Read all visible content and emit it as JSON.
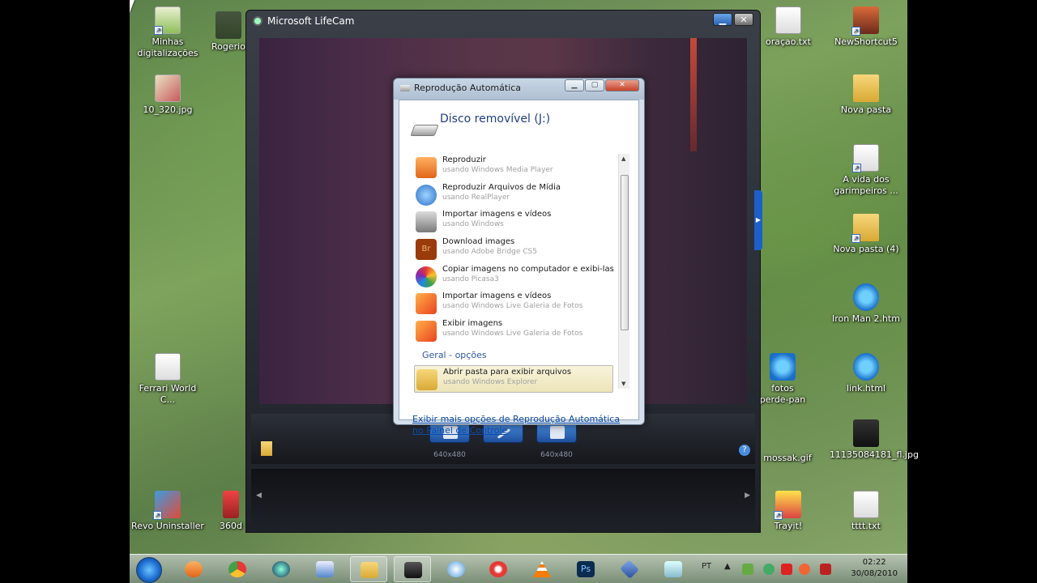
{
  "desktop": {
    "icons_left": [
      {
        "label": "Minhas digitalizações",
        "icon": "scanner-folder-icon"
      },
      {
        "label": "Rogerio",
        "icon": "folder-icon"
      },
      {
        "label": "10_320.jpg",
        "icon": "image-file-icon"
      },
      {
        "label": "Ferrari World C...",
        "icon": "file-icon"
      },
      {
        "label": "Revo Uninstaller",
        "icon": "uninstaller-icon"
      },
      {
        "label": "360d",
        "icon": "app-icon"
      }
    ],
    "icons_right": [
      {
        "label": "oraçao.txt",
        "icon": "text-file-icon"
      },
      {
        "label": "NewShortcut5",
        "icon": "game-icon"
      },
      {
        "label": "Nova pasta",
        "icon": "folder-icon"
      },
      {
        "label": "A vida dos garimpeiros ...",
        "icon": "file-icon"
      },
      {
        "label": "Nova pasta (4)",
        "icon": "folder-icon"
      },
      {
        "label": "Iron Man 2.htm",
        "icon": "ie-icon"
      },
      {
        "label": "fotos perde-pan",
        "icon": "image-file-icon"
      },
      {
        "label": "link.html",
        "icon": "ie-icon"
      },
      {
        "label": "mossak.gif",
        "icon": "image-file-icon"
      },
      {
        "label": "11135084181_fl.jpg",
        "icon": "image-file-icon"
      },
      {
        "label": "Trayit!",
        "icon": "trayit-icon"
      },
      {
        "label": "tttt.txt",
        "icon": "text-file-icon"
      }
    ]
  },
  "lifecam": {
    "title": "Microsoft LifeCam",
    "resolution_left": "640x480",
    "resolution_right": "640x480",
    "help": "?"
  },
  "autoplay": {
    "title": "Reprodução Automática",
    "drive": "Disco removível (J:)",
    "items": [
      {
        "main": "Reproduzir",
        "sub": "usando Windows Media Player",
        "color": "#f08a24"
      },
      {
        "main": "Reproduzir Arquivos de Mídia",
        "sub": "usando RealPlayer",
        "color": "#2a6fc9"
      },
      {
        "main": "Importar imagens e vídeos",
        "sub": "usando Windows",
        "color": "#8a8a8a"
      },
      {
        "main": "Download images",
        "sub": "usando Adobe Bridge CS5",
        "color": "#a0400f"
      },
      {
        "main": "Copiar imagens no computador e exibi-las",
        "sub": "usando Picasa3",
        "color": "#5ab246"
      },
      {
        "main": "Importar imagens e vídeos",
        "sub": "usando Windows Live Galeria de Fotos",
        "color": "#e8641e"
      },
      {
        "main": "Exibir imagens",
        "sub": "usando Windows Live Galeria de Fotos",
        "color": "#e8641e"
      }
    ],
    "section": "Geral - opções",
    "general_item": {
      "main": "Abrir pasta para exibir arquivos",
      "sub": "usando Windows Explorer"
    },
    "link": "Exibir mais opções de Reprodução Automática no Painel de Controle"
  },
  "taskbar": {
    "lang": "PT",
    "time": "02:22",
    "date": "30/08/2010"
  }
}
